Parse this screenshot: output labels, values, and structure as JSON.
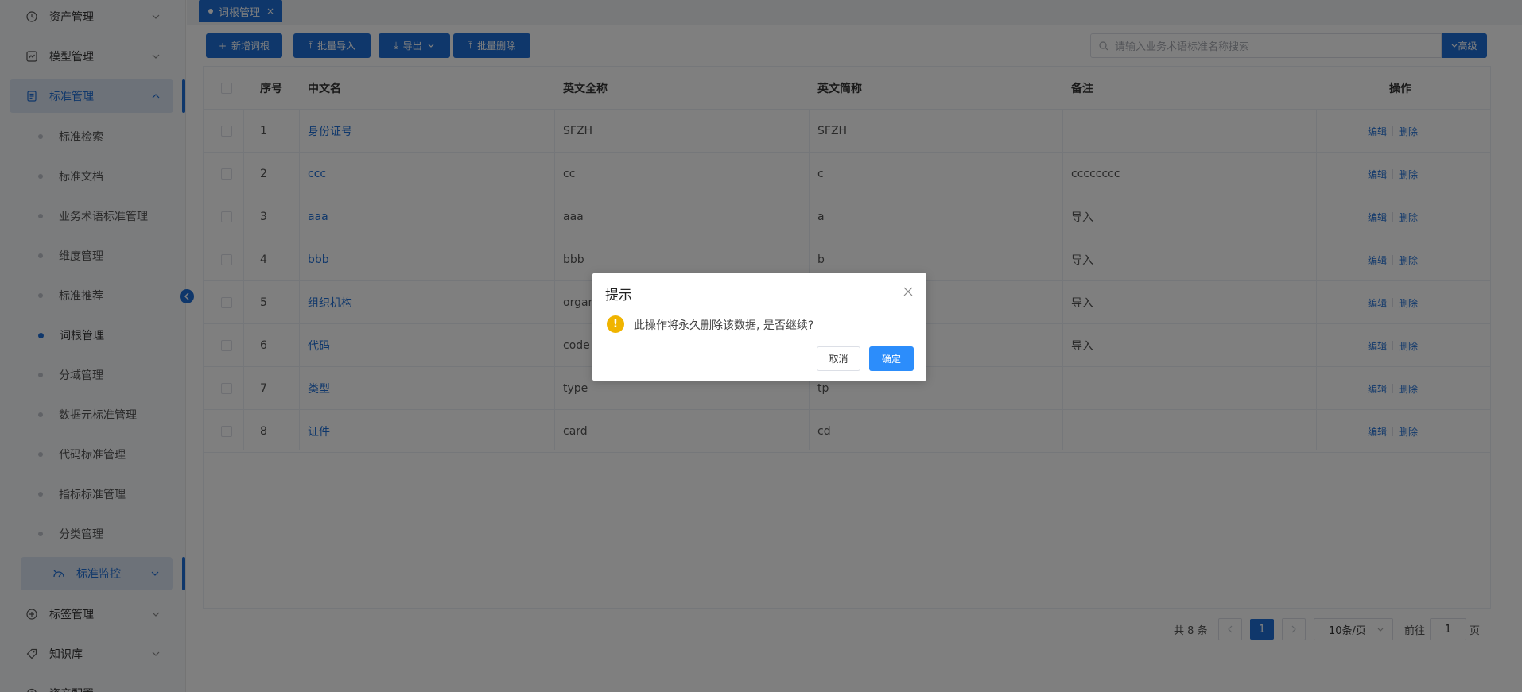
{
  "sidebar": {
    "menus": [
      {
        "label": "资产管理",
        "icon": "clock-icon"
      },
      {
        "label": "模型管理",
        "icon": "chart-box-icon"
      },
      {
        "label": "标准管理",
        "icon": "document-icon"
      }
    ],
    "sub_items": [
      {
        "label": "标准检索"
      },
      {
        "label": "标准文档"
      },
      {
        "label": "业务术语标准管理"
      },
      {
        "label": "维度管理"
      },
      {
        "label": "标准推荐"
      },
      {
        "label": "词根管理"
      },
      {
        "label": "分域管理"
      },
      {
        "label": "数据元标准管理"
      },
      {
        "label": "代码标准管理"
      },
      {
        "label": "指标标准管理"
      },
      {
        "label": "分类管理"
      }
    ],
    "sub_open_label": "标准监控",
    "bottom_menus": [
      {
        "label": "标签管理"
      },
      {
        "label": "知识库"
      },
      {
        "label": "资产配置"
      }
    ]
  },
  "tabs": [
    {
      "label": "词根管理"
    }
  ],
  "toolbar": {
    "add_label": "新增词根",
    "import_label": "批量导入",
    "export_label": "导出",
    "batch_delete_label": "批量删除",
    "search_placeholder": "请输入业务术语标准名称搜索",
    "advanced_label": "高级"
  },
  "table": {
    "headers": {
      "index": "序号",
      "cn_name": "中文名",
      "en_full": "英文全称",
      "en_short": "英文简称",
      "remark": "备注",
      "ops": "操作"
    },
    "rows": [
      {
        "index": "1",
        "cn_name": "身份证号",
        "en_full": "SFZH",
        "en_short": "SFZH",
        "remark": ""
      },
      {
        "index": "2",
        "cn_name": "ccc",
        "en_full": "cc",
        "en_short": "c",
        "remark": "cccccccc"
      },
      {
        "index": "3",
        "cn_name": "aaa",
        "en_full": "aaa",
        "en_short": "a",
        "remark": "导入"
      },
      {
        "index": "4",
        "cn_name": "bbb",
        "en_full": "bbb",
        "en_short": "b",
        "remark": "导入"
      },
      {
        "index": "5",
        "cn_name": "组织机构",
        "en_full": "organ",
        "en_short": "",
        "remark": "导入"
      },
      {
        "index": "6",
        "cn_name": "代码",
        "en_full": "code",
        "en_short": "",
        "remark": "导入"
      },
      {
        "index": "7",
        "cn_name": "类型",
        "en_full": "type",
        "en_short": "tp",
        "remark": ""
      },
      {
        "index": "8",
        "cn_name": "证件",
        "en_full": "card",
        "en_short": "cd",
        "remark": ""
      }
    ],
    "edit_label": "编辑",
    "delete_label": "删除"
  },
  "pagination": {
    "total_text": "共 8 条",
    "current_page": "1",
    "page_size": "10条/页",
    "goto_prefix": "前往",
    "goto_value": "1",
    "goto_suffix": "页"
  },
  "dialog": {
    "title": "提示",
    "message": "此操作将永久删除该数据, 是否继续?",
    "cancel_label": "取消",
    "confirm_label": "确定"
  },
  "colors": {
    "primary": "#1f6fd6",
    "warning": "#f0b400"
  }
}
